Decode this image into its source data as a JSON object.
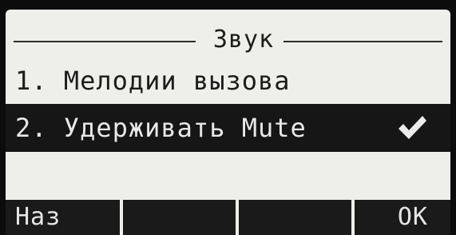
{
  "screen": {
    "title": "Звук"
  },
  "menu": {
    "items": [
      {
        "label": "1. Мелодии вызова",
        "selected": false
      },
      {
        "label": "2. Удерживать Mute",
        "selected": true,
        "checked": true,
        "check_icon": "checkmark-icon"
      }
    ]
  },
  "softkeys": [
    {
      "label": "Наз"
    },
    {
      "label": ""
    },
    {
      "label": ""
    },
    {
      "label": "OK"
    }
  ]
}
